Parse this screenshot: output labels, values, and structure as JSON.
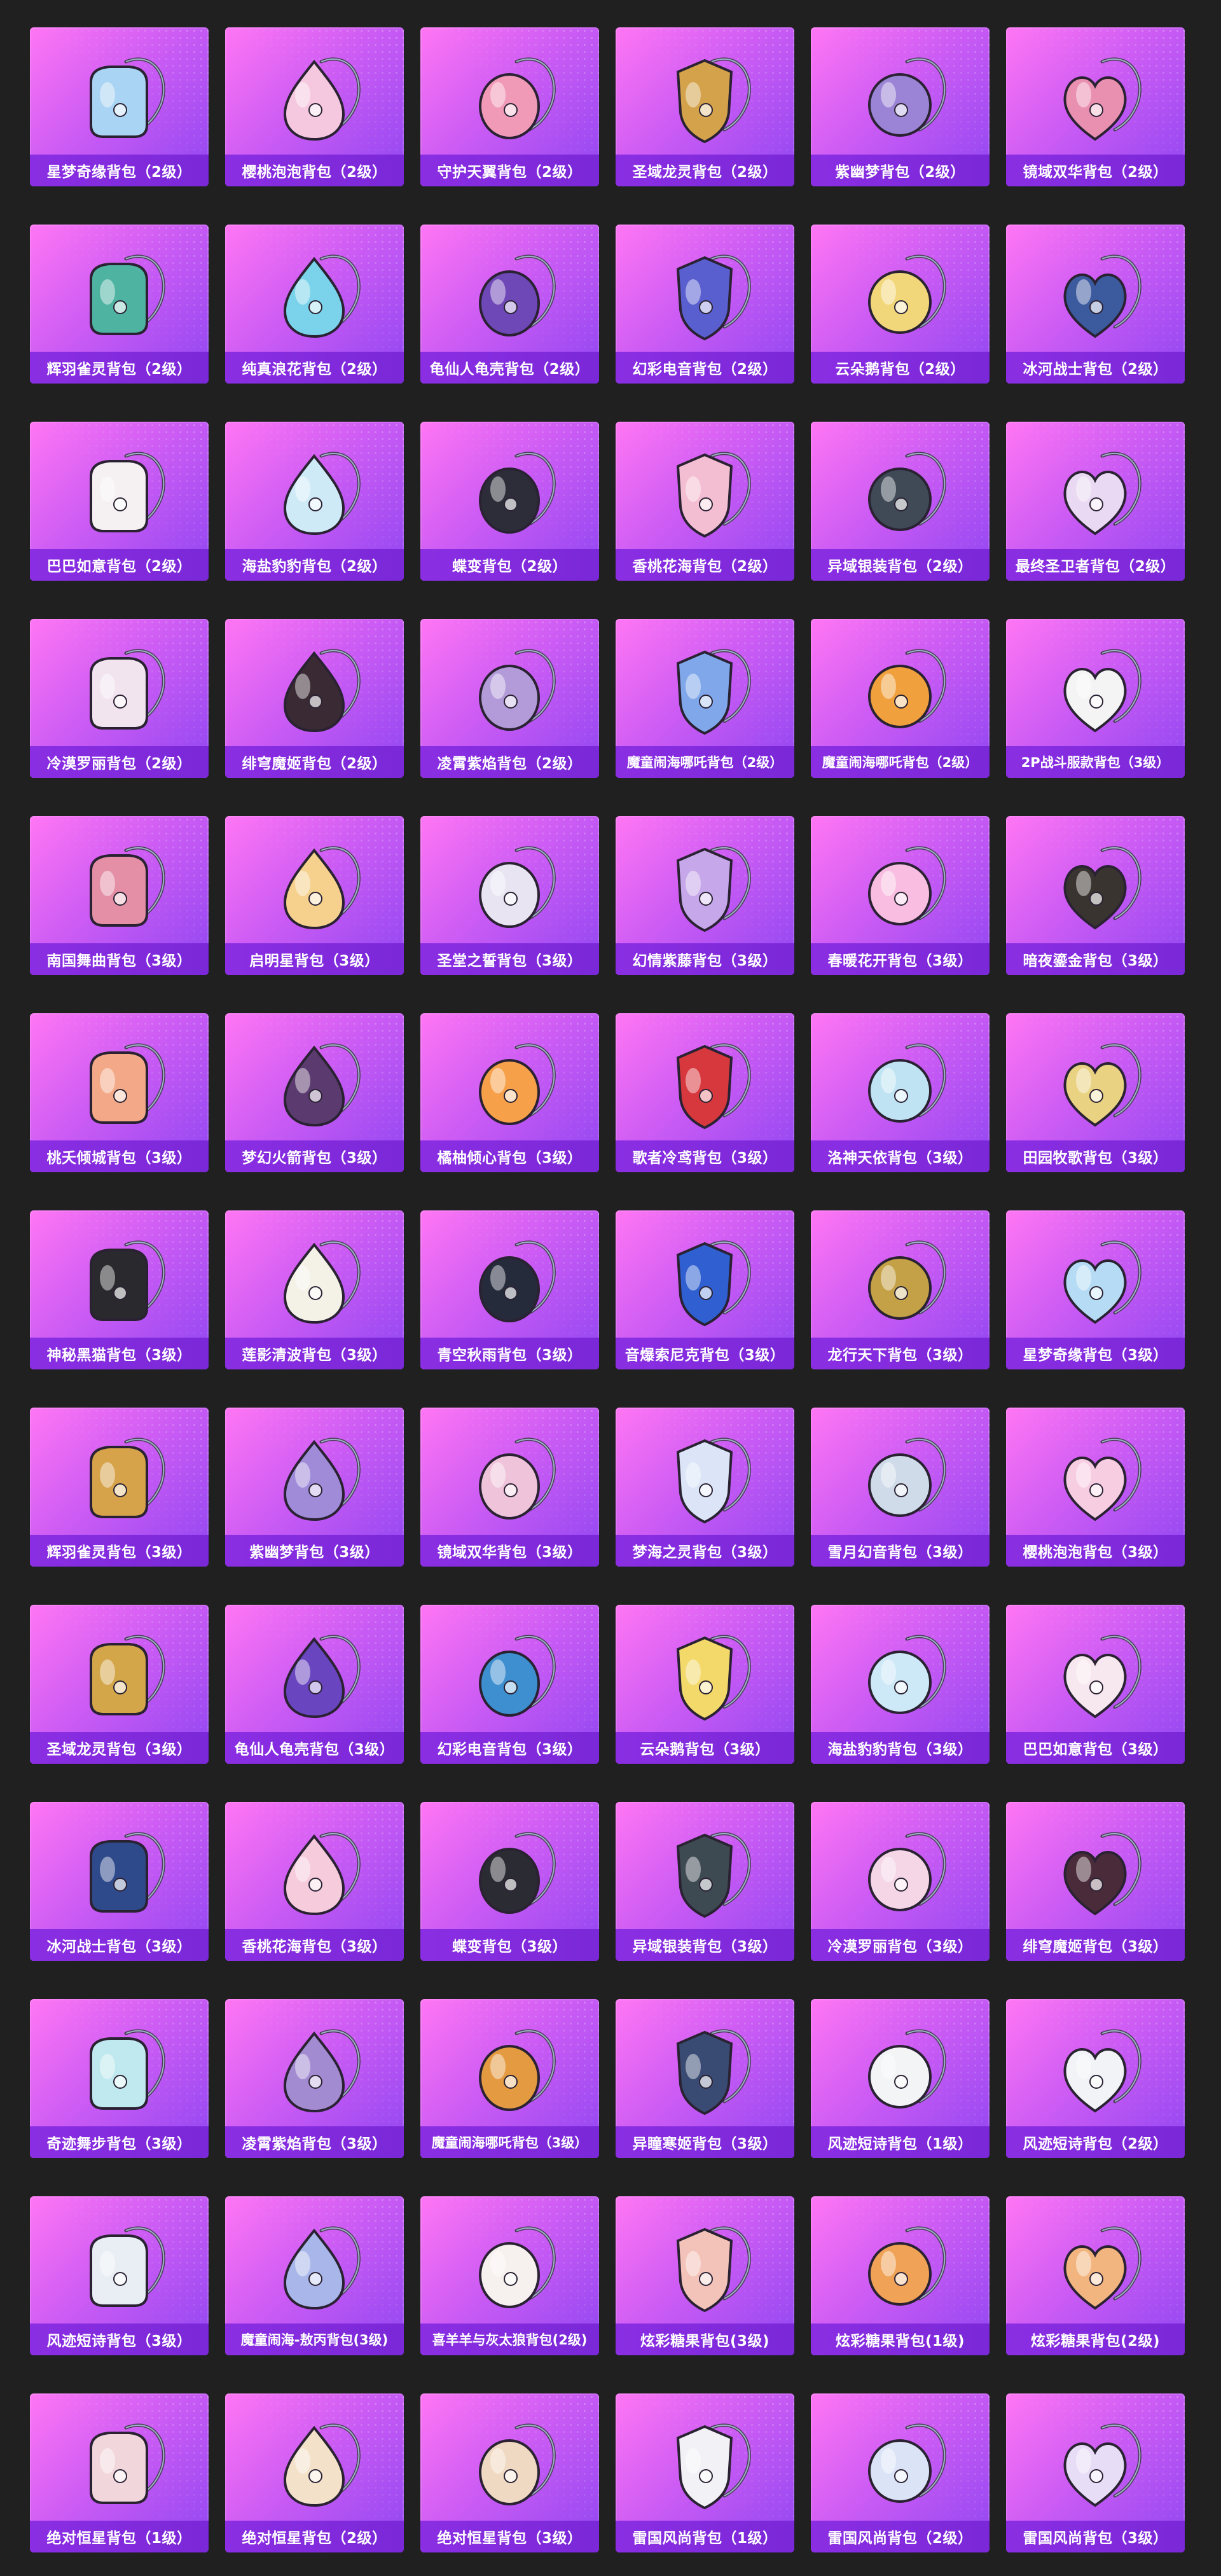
{
  "items": [
    {
      "label": "星梦奇缘背包（2级）",
      "color": "#a9d4f3"
    },
    {
      "label": "樱桃泡泡背包（2级）",
      "color": "#f6c8e0"
    },
    {
      "label": "守护天翼背包（2级）",
      "color": "#f19ab8"
    },
    {
      "label": "圣域龙灵背包（2级）",
      "color": "#d3a24a"
    },
    {
      "label": "紫幽梦背包（2级）",
      "color": "#9b84d6"
    },
    {
      "label": "镜域双华背包（2级）",
      "color": "#e98fb0"
    },
    {
      "label": "辉羽雀灵背包（2级）",
      "color": "#4fb3a2"
    },
    {
      "label": "纯真浪花背包（2级）",
      "color": "#7ad3ea"
    },
    {
      "label": "龟仙人龟壳背包（2级）",
      "color": "#6f48b8"
    },
    {
      "label": "幻彩电音背包（2级）",
      "color": "#5a5fcf"
    },
    {
      "label": "云朵鹅背包（2级）",
      "color": "#f2d77a"
    },
    {
      "label": "冰河战士背包（2级）",
      "color": "#3c5a9e"
    },
    {
      "label": "巴巴如意背包（2级）",
      "color": "#f5f0f2"
    },
    {
      "label": "海盐豹豹背包（2级）",
      "color": "#cfeaf7"
    },
    {
      "label": "蝶变背包（2级）",
      "color": "#2d2d3a"
    },
    {
      "label": "香桃花海背包（2级）",
      "color": "#f4bed2"
    },
    {
      "label": "异域银装背包（2级）",
      "color": "#3f4a56"
    },
    {
      "label": "最终圣卫者背包（2级）",
      "color": "#ead9f2"
    },
    {
      "label": "冷漠罗丽背包（2级）",
      "color": "#f1e4ef"
    },
    {
      "label": "绯穹魔姬背包（2级）",
      "color": "#3a2a33"
    },
    {
      "label": "凌霄紫焰背包（2级）",
      "color": "#b39bd9"
    },
    {
      "label": "魔童闹海哪吒背包（2级）",
      "color": "#7fa7ea"
    },
    {
      "label": "魔童闹海哪吒背包（2级）",
      "color": "#f0a03c"
    },
    {
      "label": "2P战斗服款背包（3级）",
      "color": "#f4f4f4"
    },
    {
      "label": "南国舞曲背包（3级）",
      "color": "#e48fa6"
    },
    {
      "label": "启明星背包（3级）",
      "color": "#f5d18d"
    },
    {
      "label": "圣堂之誓背包（3级）",
      "color": "#e8e4f2"
    },
    {
      "label": "幻情紫藤背包（3级）",
      "color": "#c6a7ea"
    },
    {
      "label": "春暖花开背包（3级）",
      "color": "#f8bde0"
    },
    {
      "label": "暗夜鎏金背包（3级）",
      "color": "#3a3430"
    },
    {
      "label": "桃夭倾城背包（3级）",
      "color": "#f3a987"
    },
    {
      "label": "梦幻火箭背包（3级）",
      "color": "#5b3b6f"
    },
    {
      "label": "橘柚倾心背包（3级）",
      "color": "#f7a04a"
    },
    {
      "label": "歌者冷鸢背包（3级）",
      "color": "#d7383e"
    },
    {
      "label": "洛神天依背包（3级）",
      "color": "#bfe3f3"
    },
    {
      "label": "田园牧歌背包（3级）",
      "color": "#e9d282"
    },
    {
      "label": "神秘黑猫背包（3级）",
      "color": "#2a2a2e"
    },
    {
      "label": "莲影清波背包（3级）",
      "color": "#f4f1e6"
    },
    {
      "label": "青空秋雨背包（3级）",
      "color": "#262b3c"
    },
    {
      "label": "音爆索尼克背包（3级）",
      "color": "#2f5fd0"
    },
    {
      "label": "龙行天下背包（3级）",
      "color": "#c4a046"
    },
    {
      "label": "星梦奇缘背包（3级）",
      "color": "#b6dcf5"
    },
    {
      "label": "辉羽雀灵背包（3级）",
      "color": "#d6a34a"
    },
    {
      "label": "紫幽梦背包（3级）",
      "color": "#a08bd9"
    },
    {
      "label": "镜域双华背包（3级）",
      "color": "#efc3da"
    },
    {
      "label": "梦海之灵背包（3级）",
      "color": "#dbe5f7"
    },
    {
      "label": "雪月幻音背包（3级）",
      "color": "#cfdbe9"
    },
    {
      "label": "樱桃泡泡背包（3级）",
      "color": "#f7cde2"
    },
    {
      "label": "圣域龙灵背包（3级）",
      "color": "#d4a64a"
    },
    {
      "label": "龟仙人龟壳背包（3级）",
      "color": "#6a45c0"
    },
    {
      "label": "幻彩电音背包（3级）",
      "color": "#3d8fd0"
    },
    {
      "label": "云朵鹅背包（3级）",
      "color": "#f3d86a"
    },
    {
      "label": "海盐豹豹背包（3级）",
      "color": "#cde8f6"
    },
    {
      "label": "巴巴如意背包（3级）",
      "color": "#f7e7ee"
    },
    {
      "label": "冰河战士背包（3级）",
      "color": "#2f4a8a"
    },
    {
      "label": "香桃花海背包（3级）",
      "color": "#f6cbdc"
    },
    {
      "label": "蝶变背包（3级）",
      "color": "#2b2b33"
    },
    {
      "label": "异域银装背包（3级）",
      "color": "#3e4a52"
    },
    {
      "label": "冷漠罗丽背包（3级）",
      "color": "#f4d6e6"
    },
    {
      "label": "绯穹魔姬背包（3级）",
      "color": "#4a2b3a"
    },
    {
      "label": "奇迹舞步背包（3级）",
      "color": "#bfe9ee"
    },
    {
      "label": "凌霄紫焰背包（3级）",
      "color": "#a38bd1"
    },
    {
      "label": "魔童闹海哪吒背包（3级）",
      "color": "#e49a40"
    },
    {
      "label": "异瞳寒姬背包（3级）",
      "color": "#3a4b73"
    },
    {
      "label": "风迹短诗背包（1级）",
      "color": "#f3f4f6"
    },
    {
      "label": "风迹短诗背包（2级）",
      "color": "#f1f3f6"
    },
    {
      "label": "风迹短诗背包（3级）",
      "color": "#e9eef5"
    },
    {
      "label": "魔童闹海-敖丙背包(3级)",
      "color": "#a9b6ea"
    },
    {
      "label": "喜羊羊与灰太狼背包(2级)",
      "color": "#f6f1ee"
    },
    {
      "label": "炫彩糖果背包(3级)",
      "color": "#f3c2b8"
    },
    {
      "label": "炫彩糖果背包(1级)",
      "color": "#f0a257"
    },
    {
      "label": "炫彩糖果背包(2级)",
      "color": "#f3b57f"
    },
    {
      "label": "绝对恒星背包（1级）",
      "color": "#f1d7dc"
    },
    {
      "label": "绝对恒星背包（2级）",
      "color": "#f3e1c9"
    },
    {
      "label": "绝对恒星背包（3级）",
      "color": "#f0d9c2"
    },
    {
      "label": "雷国风尚背包（1级）",
      "color": "#f2f2f6"
    },
    {
      "label": "雷国风尚背包（2级）",
      "color": "#dbe3f6"
    },
    {
      "label": "雷国风尚背包（3级）",
      "color": "#e7ddf6"
    }
  ]
}
